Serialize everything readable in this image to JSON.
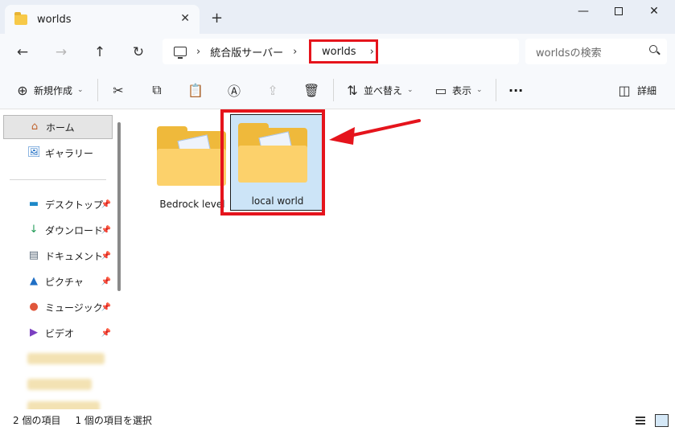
{
  "window": {
    "tab_title": "worlds",
    "new_tab": "+",
    "tab_close": "✕",
    "minimize": "—",
    "close": "✕"
  },
  "address": {
    "crumbs": [
      "統合版サーバー",
      "worlds"
    ],
    "separator": "›",
    "search_placeholder": "worldsの検索"
  },
  "toolbar": {
    "new_label": "新規作成",
    "sort_label": "並べ替え",
    "view_label": "表示",
    "more_label": "···",
    "details_label": "詳細"
  },
  "sidebar": {
    "home": "ホーム",
    "gallery": "ギャラリー",
    "items": [
      {
        "label": "デスクトップ",
        "icon": "desktop-icon"
      },
      {
        "label": "ダウンロード",
        "icon": "download-icon"
      },
      {
        "label": "ドキュメント",
        "icon": "documents-icon"
      },
      {
        "label": "ピクチャ",
        "icon": "pictures-icon"
      },
      {
        "label": "ミュージック",
        "icon": "music-icon"
      },
      {
        "label": "ビデオ",
        "icon": "videos-icon"
      }
    ]
  },
  "content": {
    "folders": [
      {
        "name": "Bedrock level",
        "selected": false
      },
      {
        "name": "local world",
        "selected": true
      }
    ]
  },
  "status": {
    "count": "2 個の項目",
    "selected": "1 個の項目を選択"
  },
  "colors": {
    "highlight": "#e5141c",
    "selection": "#cce4f7",
    "folder": "#fcd16b"
  }
}
